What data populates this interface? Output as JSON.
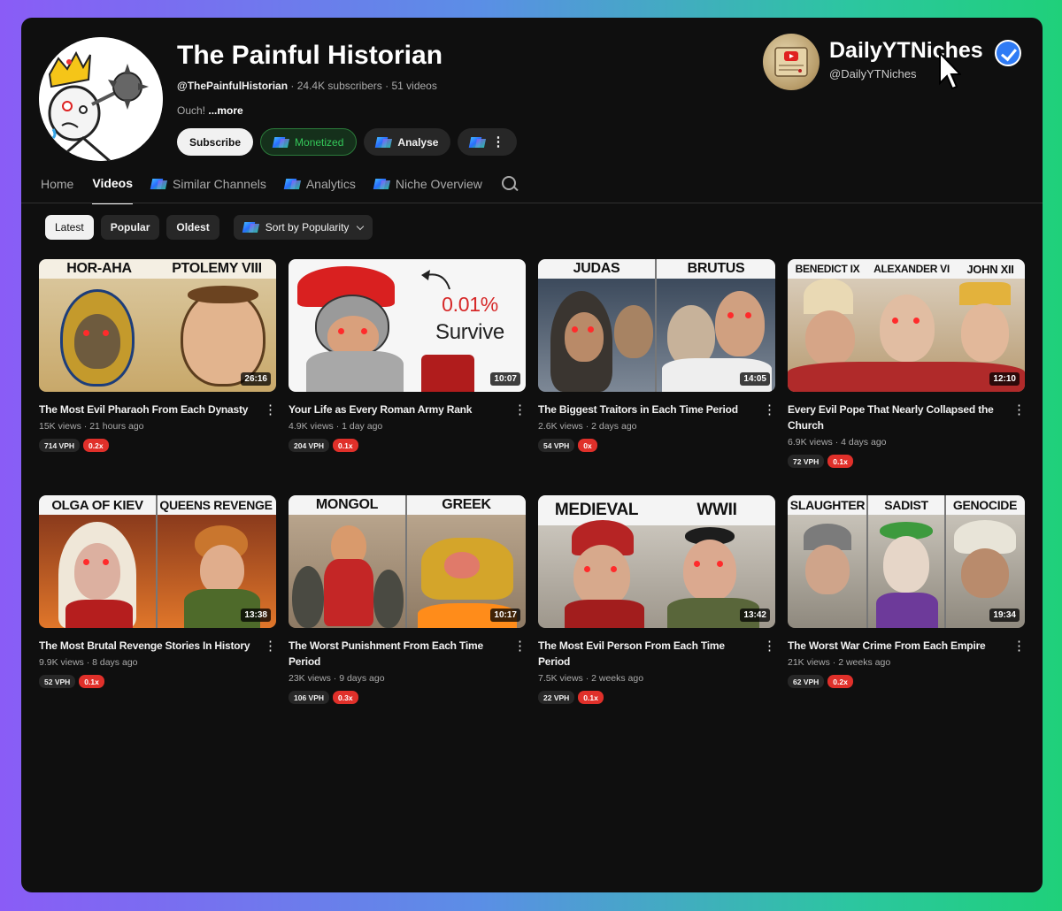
{
  "channel": {
    "name": "The Painful Historian",
    "handle": "@ThePainfulHistorian",
    "subscribers": "24.4K subscribers",
    "videos_count": "51 videos",
    "separator": "·",
    "description": "Ouch!",
    "more_label": "...more",
    "buttons": {
      "subscribe": "Subscribe",
      "monetized": "Monetized",
      "analyse": "Analyse"
    }
  },
  "brand": {
    "name": "DailyYTNiches",
    "handle": "@DailyYTNiches"
  },
  "tabs": [
    {
      "label": "Home",
      "active": false
    },
    {
      "label": "Videos",
      "active": true
    },
    {
      "label": "Similar Channels",
      "active": false
    },
    {
      "label": "Analytics",
      "active": false
    },
    {
      "label": "Niche Overview",
      "active": false
    }
  ],
  "filters": {
    "chips": [
      "Latest",
      "Popular",
      "Oldest"
    ],
    "sort_label": "Sort by Popularity"
  },
  "videos": [
    {
      "title": "The Most Evil Pharaoh From Each Dynasty",
      "views": "15K views",
      "age": "21 hours ago",
      "duration": "26:16",
      "vph": "714 VPH",
      "ratio": "0.2x",
      "thumb_labels": [
        "HOR-AHA",
        "PTOLEMY VIII"
      ]
    },
    {
      "title": "Your Life as Every Roman Army Rank",
      "views": "4.9K views",
      "age": "1 day ago",
      "duration": "10:07",
      "vph": "204 VPH",
      "ratio": "0.1x",
      "thumb_labels": [
        "0.01%",
        "Survive"
      ]
    },
    {
      "title": "The Biggest Traitors in Each Time Period",
      "views": "2.6K views",
      "age": "2 days ago",
      "duration": "14:05",
      "vph": "54 VPH",
      "ratio": "0x",
      "thumb_labels": [
        "JUDAS",
        "BRUTUS"
      ]
    },
    {
      "title": "Every Evil Pope That Nearly Collapsed the Church",
      "views": "6.9K views",
      "age": "4 days ago",
      "duration": "12:10",
      "vph": "72 VPH",
      "ratio": "0.1x",
      "thumb_labels": [
        "BENEDICT IX",
        "ALEXANDER VI",
        "JOHN XII"
      ]
    },
    {
      "title": "The Most Brutal Revenge Stories In History",
      "views": "9.9K views",
      "age": "8 days ago",
      "duration": "13:38",
      "vph": "52 VPH",
      "ratio": "0.1x",
      "thumb_labels": [
        "OLGA OF KIEV",
        "QUEENS REVENGE"
      ]
    },
    {
      "title": "The Worst Punishment From Each Time Period",
      "views": "23K views",
      "age": "9 days ago",
      "duration": "10:17",
      "vph": "106 VPH",
      "ratio": "0.3x",
      "thumb_labels": [
        "MONGOL",
        "GREEK"
      ]
    },
    {
      "title": "The Most Evil Person From Each Time Period",
      "views": "7.5K views",
      "age": "2 weeks ago",
      "duration": "13:42",
      "vph": "22 VPH",
      "ratio": "0.1x",
      "thumb_labels": [
        "MEDIEVAL",
        "WWII"
      ]
    },
    {
      "title": "The Worst War Crime From Each Empire",
      "views": "21K views",
      "age": "2 weeks ago",
      "duration": "19:34",
      "vph": "62 VPH",
      "ratio": "0.2x",
      "thumb_labels": [
        "SLAUGHTER",
        "SADIST",
        "GENOCIDE"
      ]
    }
  ],
  "colors": {
    "background": "#0f0f0f",
    "accent_green": "#34c759",
    "ratio_red": "#e0302a",
    "verified_blue": "#2f7bf5"
  },
  "icons": {
    "search": "search-icon",
    "verified": "verified-icon",
    "kebab": "more-vert-icon",
    "cursor": "mouse-pointer-icon"
  }
}
